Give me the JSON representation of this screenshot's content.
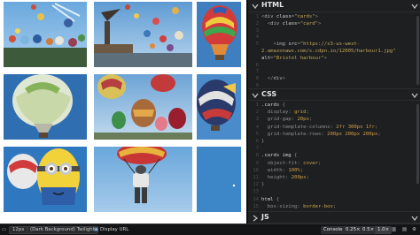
{
  "preview": {
    "images": [
      {
        "name": "tile-balloons-sky-1"
      },
      {
        "name": "tile-harbour-crane"
      },
      {
        "name": "tile-balloon-striped-closeup"
      },
      {
        "name": "tile-balloon-green-blue"
      },
      {
        "name": "tile-balloons-many"
      },
      {
        "name": "tile-balloon-dark-red"
      },
      {
        "name": "tile-minion-balloon"
      },
      {
        "name": "tile-balloon-figure"
      },
      {
        "name": "tile-blue-edge"
      }
    ]
  },
  "editor": {
    "html_pane": {
      "title": "HTML",
      "lines": [
        {
          "n": "1",
          "parts": [
            [
              "pun",
              "<"
            ],
            [
              "tag",
              "div"
            ],
            [
              "attr",
              " class"
            ],
            [
              "pun",
              "="
            ],
            [
              "str",
              "\"cards\""
            ],
            [
              "pun",
              ">"
            ]
          ]
        },
        {
          "n": "2",
          "parts": [
            [
              "pun",
              "  <"
            ],
            [
              "tag",
              "div"
            ],
            [
              "attr",
              " class"
            ],
            [
              "pun",
              "="
            ],
            [
              "str",
              "\"card\""
            ],
            [
              "pun",
              ">"
            ]
          ]
        },
        {
          "n": "3",
          "parts": []
        },
        {
          "n": "4",
          "parts": []
        },
        {
          "n": "5",
          "parts": [
            [
              "pun",
              "    <"
            ],
            [
              "tag",
              "img"
            ],
            [
              "attr",
              " src"
            ],
            [
              "pun",
              "="
            ],
            [
              "str",
              "\"https://s3-us-west-"
            ]
          ]
        },
        {
          "n": "",
          "parts": [
            [
              "str",
              "2.amazonaws.com/s.cdpn.io/12005/harbour1.jpg\""
            ]
          ]
        },
        {
          "n": "",
          "parts": [
            [
              "attr",
              "alt"
            ],
            [
              "pun",
              "="
            ],
            [
              "str",
              "\"Bristol harbour\""
            ],
            [
              "pun",
              ">"
            ]
          ]
        },
        {
          "n": "6",
          "parts": []
        },
        {
          "n": "7",
          "parts": []
        },
        {
          "n": "8",
          "parts": [
            [
              "pun",
              "  </"
            ],
            [
              "tag",
              "div"
            ],
            [
              "pun",
              ">"
            ]
          ]
        },
        {
          "n": "9",
          "parts": []
        }
      ]
    },
    "css_pane": {
      "title": "CSS",
      "lines": [
        {
          "n": "1",
          "parts": [
            [
              "sel",
              ".cards "
            ],
            [
              "pun",
              "{"
            ]
          ]
        },
        {
          "n": "2",
          "parts": [
            [
              "prop",
              "  display"
            ],
            [
              "pun",
              ": "
            ],
            [
              "val",
              "grid"
            ],
            [
              "pun",
              ";"
            ]
          ]
        },
        {
          "n": "3",
          "parts": [
            [
              "prop",
              "  grid-gap"
            ],
            [
              "pun",
              ": "
            ],
            [
              "num",
              "20px"
            ],
            [
              "pun",
              ";"
            ]
          ]
        },
        {
          "n": "4",
          "parts": [
            [
              "prop",
              "  grid-template-columns"
            ],
            [
              "pun",
              ": "
            ],
            [
              "num",
              "2fr 300px 1fr"
            ],
            [
              "pun",
              ";"
            ]
          ]
        },
        {
          "n": "5",
          "parts": [
            [
              "prop",
              "  grid-template-rows"
            ],
            [
              "pun",
              ": "
            ],
            [
              "num",
              "200px 200px 200px"
            ],
            [
              "pun",
              ";"
            ]
          ]
        },
        {
          "n": "6",
          "parts": [
            [
              "pun",
              "}"
            ]
          ]
        },
        {
          "n": "7",
          "parts": []
        },
        {
          "n": "8",
          "parts": [
            [
              "sel",
              ".cards img "
            ],
            [
              "pun",
              "{"
            ]
          ]
        },
        {
          "n": "9",
          "parts": [
            [
              "prop",
              "  object-fit"
            ],
            [
              "pun",
              ": "
            ],
            [
              "val",
              "cover"
            ],
            [
              "pun",
              ";"
            ]
          ]
        },
        {
          "n": "10",
          "parts": [
            [
              "prop",
              "  width"
            ],
            [
              "pun",
              ": "
            ],
            [
              "num",
              "100%"
            ],
            [
              "pun",
              ";"
            ]
          ]
        },
        {
          "n": "11",
          "parts": [
            [
              "prop",
              "  height"
            ],
            [
              "pun",
              ": "
            ],
            [
              "num",
              "200px"
            ],
            [
              "pun",
              ";"
            ]
          ]
        },
        {
          "n": "12",
          "parts": [
            [
              "pun",
              "}"
            ]
          ]
        },
        {
          "n": "13",
          "parts": []
        },
        {
          "n": "14",
          "parts": [
            [
              "sel",
              "html "
            ],
            [
              "pun",
              "{"
            ]
          ]
        },
        {
          "n": "15",
          "parts": [
            [
              "prop",
              "  box-sizing"
            ],
            [
              "pun",
              ": "
            ],
            [
              "val",
              "border-box"
            ],
            [
              "pun",
              ";"
            ]
          ]
        }
      ]
    },
    "js_pane": {
      "title": "JS"
    }
  },
  "toolbar": {
    "zoom": "12px",
    "theme": "(Dark Background) Twilight",
    "display_url": "Display URL",
    "console": "Console",
    "scale_1": "0.25×",
    "scale_2": "0.5×",
    "scale_3": "1.0×"
  },
  "colors": {
    "editor_bg": "#1d1f20",
    "toolbar_bg": "#131415",
    "sky_blue": "#3f86c6"
  }
}
